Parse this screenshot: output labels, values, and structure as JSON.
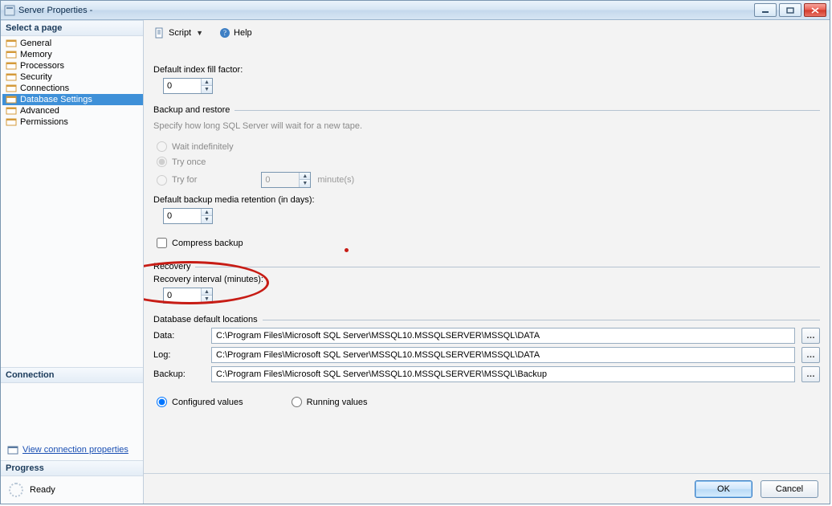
{
  "title": "Server Properties -",
  "left": {
    "select_page": "Select a page",
    "pages": [
      {
        "label": "General"
      },
      {
        "label": "Memory"
      },
      {
        "label": "Processors"
      },
      {
        "label": "Security"
      },
      {
        "label": "Connections"
      },
      {
        "label": "Database Settings"
      },
      {
        "label": "Advanced"
      },
      {
        "label": "Permissions"
      }
    ],
    "connection_head": "Connection",
    "view_conn_props": "View connection properties",
    "progress_head": "Progress",
    "ready": "Ready"
  },
  "toolbar": {
    "script": "Script",
    "help": "Help"
  },
  "form": {
    "fill_factor_label": "Default index fill factor:",
    "fill_factor_value": "0",
    "backup_restore_head": "Backup and restore",
    "tape_hint": "Specify how long SQL Server will wait for a new tape.",
    "wait_indef": "Wait indefinitely",
    "try_once": "Try once",
    "try_for": "Try for",
    "try_for_value": "0",
    "minutes": "minute(s)",
    "retention_label": "Default backup media retention (in days):",
    "retention_value": "0",
    "compress_backup": "Compress backup",
    "recovery_head": "Recovery",
    "recovery_interval_label": "Recovery interval (minutes):",
    "recovery_interval_value": "0",
    "db_locations_head": "Database default locations",
    "data_label": "Data:",
    "data_path": "C:\\Program Files\\Microsoft SQL Server\\MSSQL10.MSSQLSERVER\\MSSQL\\DATA",
    "log_label": "Log:",
    "log_path": "C:\\Program Files\\Microsoft SQL Server\\MSSQL10.MSSQLSERVER\\MSSQL\\DATA",
    "backup_label": "Backup:",
    "backup_path": "C:\\Program Files\\Microsoft SQL Server\\MSSQL10.MSSQLSERVER\\MSSQL\\Backup",
    "configured": "Configured values",
    "running": "Running values"
  },
  "buttons": {
    "ok": "OK",
    "cancel": "Cancel"
  }
}
